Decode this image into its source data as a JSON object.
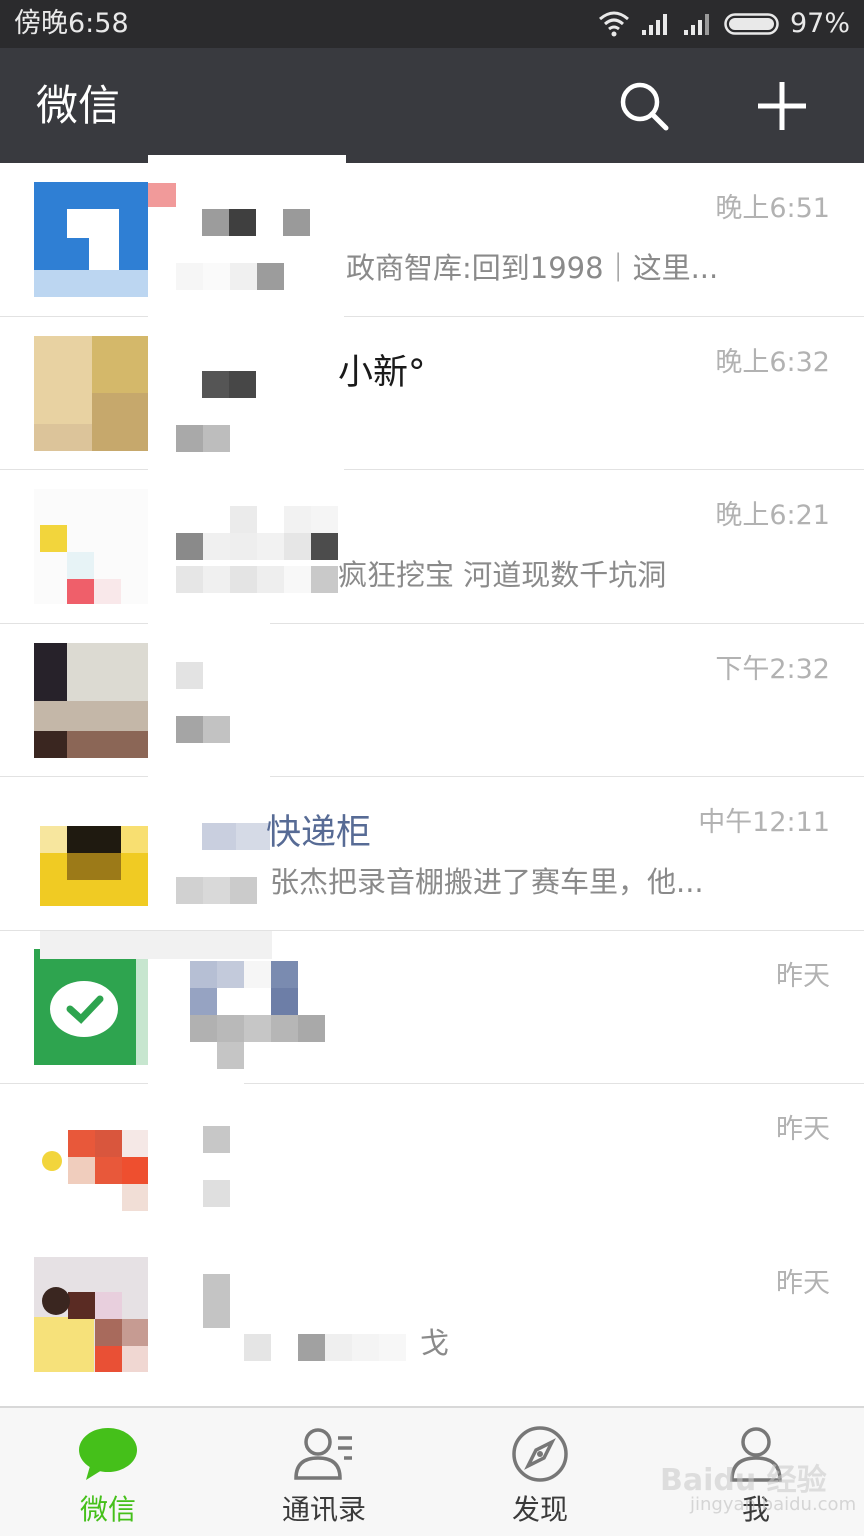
{
  "status_bar": {
    "time": "傍晚6:58",
    "battery": "97%"
  },
  "title_bar": {
    "title": "微信"
  },
  "chats": [
    {
      "name": "",
      "preview": "政商智库:回到1998｜这里...",
      "time": "晚上6:51"
    },
    {
      "name": "小新°",
      "preview": "",
      "time": "晚上6:32"
    },
    {
      "name": "",
      "preview": "疯狂挖宝 河道现数千坑洞",
      "time": "晚上6:21"
    },
    {
      "name": "",
      "preview": "",
      "time": "下午2:32"
    },
    {
      "name": "快递柜",
      "preview": "张杰把录音棚搬进了赛车里，他...",
      "time": "中午12:11"
    },
    {
      "name": "",
      "preview": "",
      "time": "昨天"
    },
    {
      "name": "",
      "preview": "",
      "time": "昨天"
    },
    {
      "name": "",
      "preview": "戈",
      "time": "昨天"
    }
  ],
  "tabs": [
    {
      "label": "微信",
      "icon": "chat-bubble-icon",
      "active": true
    },
    {
      "label": "通讯录",
      "icon": "contacts-icon",
      "active": false
    },
    {
      "label": "发现",
      "icon": "compass-icon",
      "active": false
    },
    {
      "label": "我",
      "icon": "person-icon",
      "active": false
    }
  ],
  "watermark": {
    "brand": "Baidu 经验",
    "url": "jingyan.baidu.com"
  },
  "colors": {
    "status_bar": "#2b2b2d",
    "title_bar": "#393a3f",
    "active_tab": "#45c01a",
    "link_name": "#576b95",
    "time": "#b2b2b2"
  }
}
